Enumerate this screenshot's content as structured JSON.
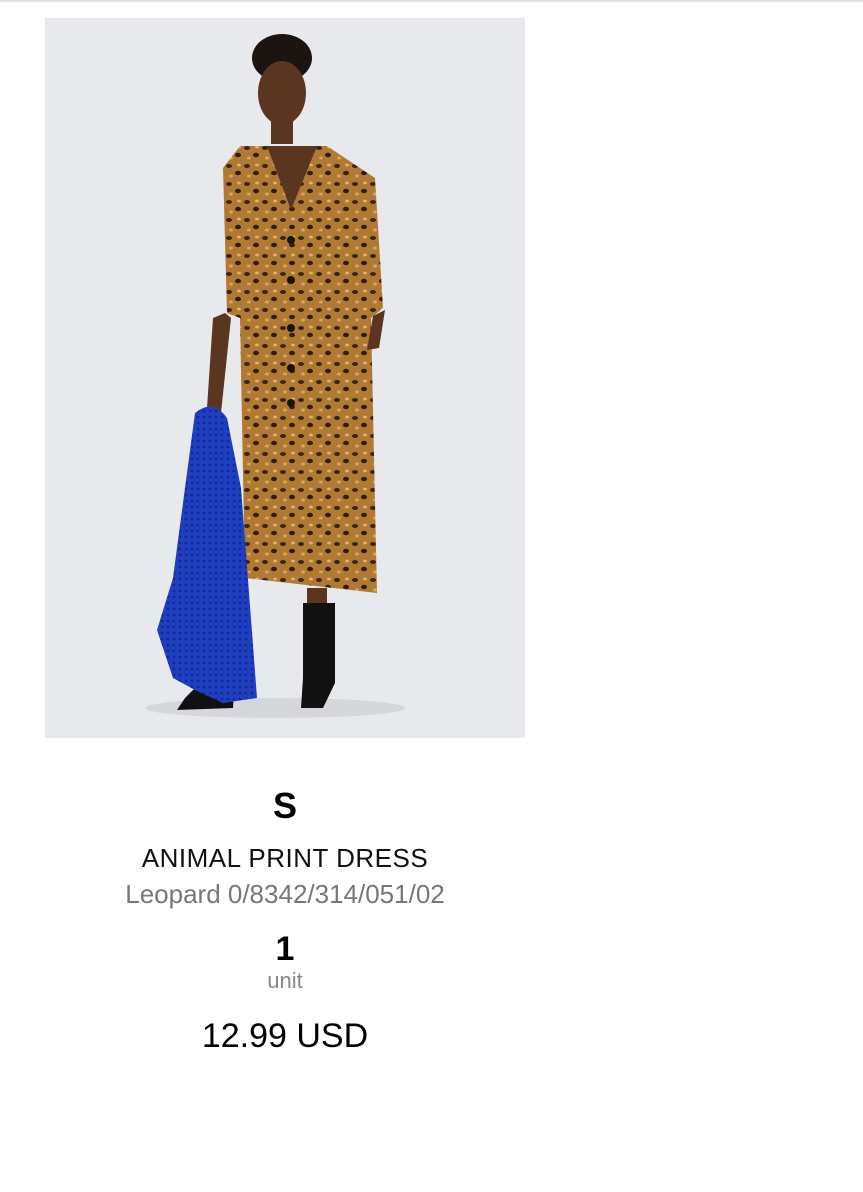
{
  "product": {
    "image_icon": "product-photo",
    "size": "S",
    "name": "ANIMAL PRINT DRESS",
    "reference": "Leopard 0/8342/314/051/02",
    "quantity": "1",
    "quantity_unit": "unit",
    "price": "12.99 USD"
  },
  "colors": {
    "background": "#ffffff",
    "photo_background": "#e8e9ec",
    "dress": "#a8742c",
    "sweater": "#1f3fc2"
  }
}
